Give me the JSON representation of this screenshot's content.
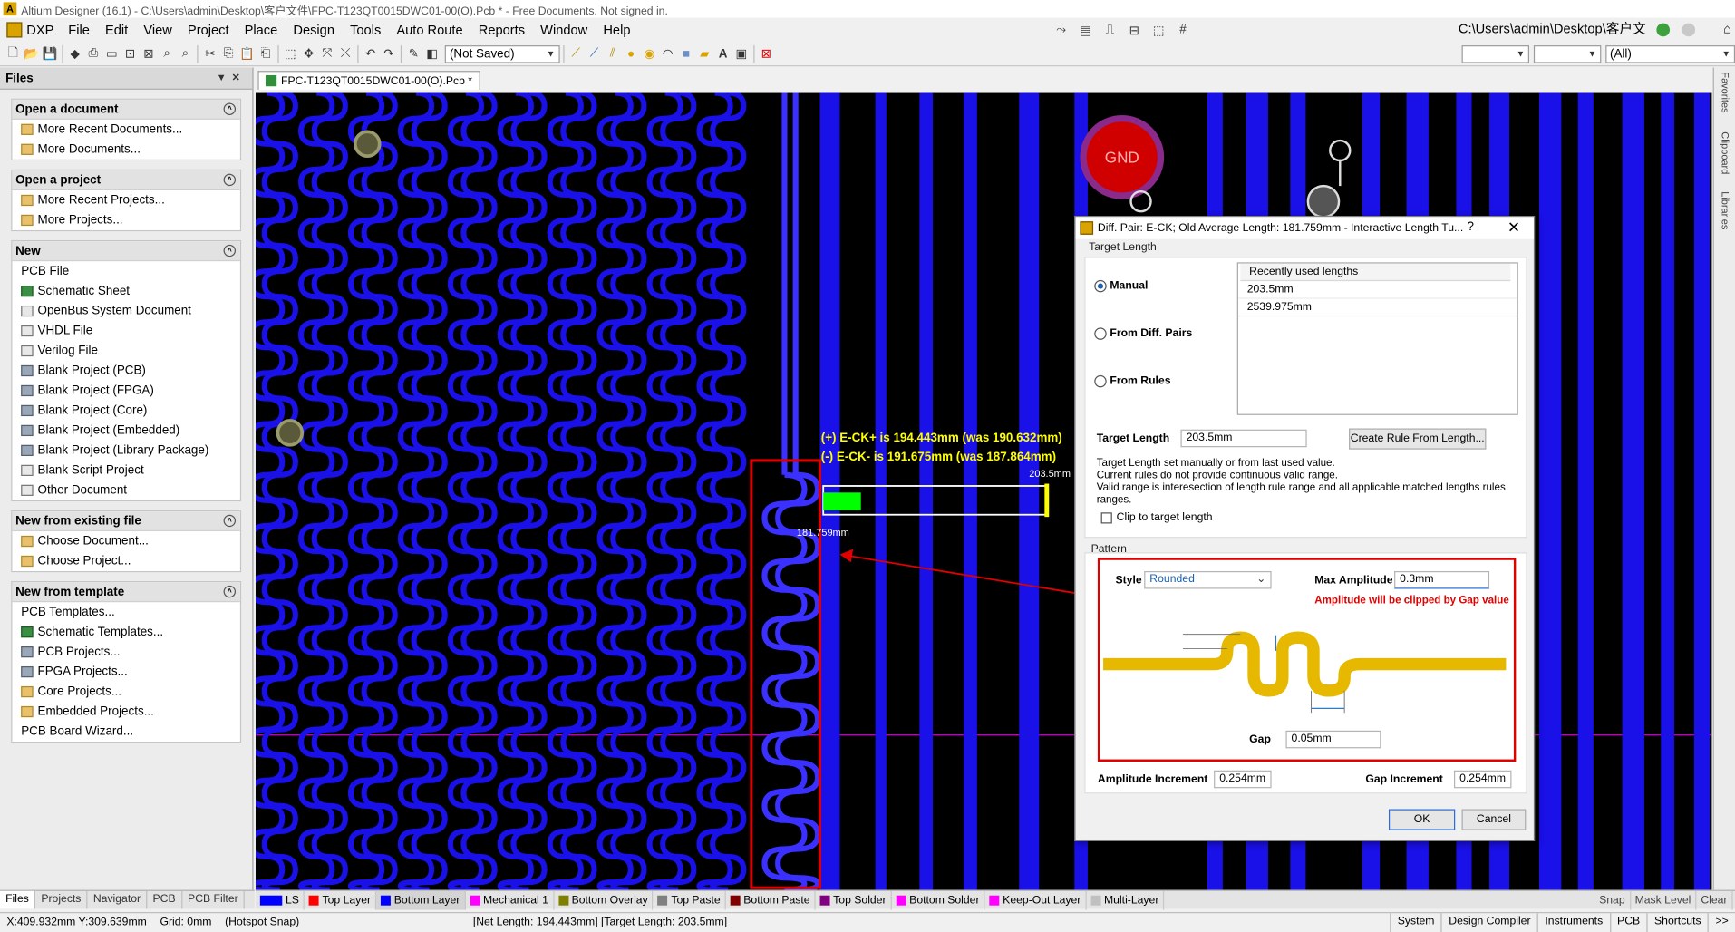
{
  "title_bar": {
    "title": "Altium Designer (16.1) - C:\\Users\\admin\\Desktop\\客户文件\\FPC-T123QT0015DWC01-00(O).Pcb * - Free Documents. Not signed in."
  },
  "menu": {
    "items": [
      "DXP",
      "File",
      "Edit",
      "View",
      "Project",
      "Place",
      "Design",
      "Tools",
      "Auto Route",
      "Reports",
      "Window",
      "Help"
    ],
    "path": "C:\\Users\\admin\\Desktop\\客户文"
  },
  "toolbar": {
    "saved_combo": "(Not Saved)",
    "filter_combo": "(All)"
  },
  "files_panel": {
    "title": "Files",
    "sections": [
      {
        "title": "Open a document",
        "items": [
          {
            "label": "More Recent Documents...",
            "icon": "folder"
          },
          {
            "label": "More Documents...",
            "icon": "folder"
          }
        ]
      },
      {
        "title": "Open a project",
        "items": [
          {
            "label": "More Recent Projects...",
            "icon": "folder"
          },
          {
            "label": "More Projects...",
            "icon": "folder"
          }
        ]
      },
      {
        "title": "New",
        "items": [
          {
            "label": "PCB File",
            "icon": "pcb"
          },
          {
            "label": "Schematic Sheet",
            "icon": "sch"
          },
          {
            "label": "OpenBus System Document",
            "icon": "doc"
          },
          {
            "label": "VHDL File",
            "icon": "doc"
          },
          {
            "label": "Verilog File",
            "icon": "doc"
          },
          {
            "label": "Blank Project (PCB)",
            "icon": "proj"
          },
          {
            "label": "Blank Project (FPGA)",
            "icon": "proj"
          },
          {
            "label": "Blank Project (Core)",
            "icon": "proj"
          },
          {
            "label": "Blank Project (Embedded)",
            "icon": "proj"
          },
          {
            "label": "Blank Project (Library Package)",
            "icon": "proj"
          },
          {
            "label": "Blank Script Project",
            "icon": "doc"
          },
          {
            "label": "Other Document",
            "icon": "doc"
          }
        ]
      },
      {
        "title": "New from existing file",
        "items": [
          {
            "label": "Choose Document...",
            "icon": "folder"
          },
          {
            "label": "Choose Project...",
            "icon": "folder"
          }
        ]
      },
      {
        "title": "New from template",
        "items": [
          {
            "label": "PCB Templates...",
            "icon": "pcb"
          },
          {
            "label": "Schematic Templates...",
            "icon": "sch"
          },
          {
            "label": "PCB Projects...",
            "icon": "proj"
          },
          {
            "label": "FPGA Projects...",
            "icon": "proj"
          },
          {
            "label": "Core Projects...",
            "icon": "folder"
          },
          {
            "label": "Embedded Projects...",
            "icon": "folder"
          },
          {
            "label": "PCB Board Wizard...",
            "icon": "pcb"
          }
        ]
      }
    ],
    "tabs": [
      "Files",
      "Projects",
      "Navigator",
      "PCB",
      "PCB Filter"
    ]
  },
  "document_tab": "FPC-T123QT0015DWC01-00(O).Pcb *",
  "right_bar": [
    "Favorites",
    "Clipboard",
    "Libraries"
  ],
  "pcb": {
    "gnd_label": "GND",
    "ep_length_text": "(+) E-CK+ is 194.443mm (was 190.632mm)",
    "en_length_text": "(-) E-CK- is 191.675mm (was 187.864mm)",
    "target_label": "203.5mm",
    "current_label": "181.759mm",
    "progress_fraction": 0.17
  },
  "layers": [
    {
      "label": "LS",
      "color": "#0000ff"
    },
    {
      "label": "Top Layer",
      "color": "#ff0000"
    },
    {
      "label": "Bottom Layer",
      "color": "#0000ff"
    },
    {
      "label": "Mechanical 1",
      "color": "#ff00ff"
    },
    {
      "label": "Bottom Overlay",
      "color": "#808000"
    },
    {
      "label": "Top Paste",
      "color": "#808080"
    },
    {
      "label": "Bottom Paste",
      "color": "#800000"
    },
    {
      "label": "Top Solder",
      "color": "#800080"
    },
    {
      "label": "Bottom Solder",
      "color": "#ff00ff"
    },
    {
      "label": "Keep-Out Layer",
      "color": "#ff00ff"
    },
    {
      "label": "Multi-Layer",
      "color": "#c0c0c0"
    }
  ],
  "layer_right": [
    "Snap",
    "Mask Level",
    "Clear"
  ],
  "status": {
    "coords": "X:409.932mm Y:309.639mm",
    "grid": "Grid: 0mm",
    "snap": "(Hotspot Snap)",
    "net_info": "[Net Length: 194.443mm] [Target Length:  203.5mm]",
    "tabs": [
      "System",
      "Design Compiler",
      "Instruments",
      "PCB",
      "Shortcuts"
    ]
  },
  "dialog": {
    "title": "Diff. Pair: E-CK;  Old Average Length: 181.759mm - Interactive Length Tu...",
    "target_length_group": "Target Length",
    "radio_manual": "Manual",
    "radio_diffpairs": "From Diff. Pairs",
    "radio_rules": "From Rules",
    "recent_header": "Recently used lengths",
    "recent_values": [
      "203.5mm",
      "2539.975mm"
    ],
    "target_length_label": "Target Length",
    "target_length_value": "203.5mm",
    "create_rule_button": "Create Rule From Length...",
    "note_lines": [
      "Target Length set manually or from last used value.",
      " Current rules do not provide continuous valid range.",
      "Valid range is interesection of length rule range and all applicable matched lengths rules ranges."
    ],
    "clip_checkbox": "Clip to target length",
    "pattern_group": "Pattern",
    "style_label": "Style",
    "style_value": "Rounded",
    "max_amp_label": "Max Amplitude",
    "max_amp_value": "0.3mm",
    "warning": "Amplitude will be clipped by Gap value",
    "gap_label": "Gap",
    "gap_value": "0.05mm",
    "amp_inc_label": "Amplitude Increment",
    "amp_inc_value": "0.254mm",
    "gap_inc_label": "Gap Increment",
    "gap_inc_value": "0.254mm",
    "ok": "OK",
    "cancel": "Cancel"
  }
}
